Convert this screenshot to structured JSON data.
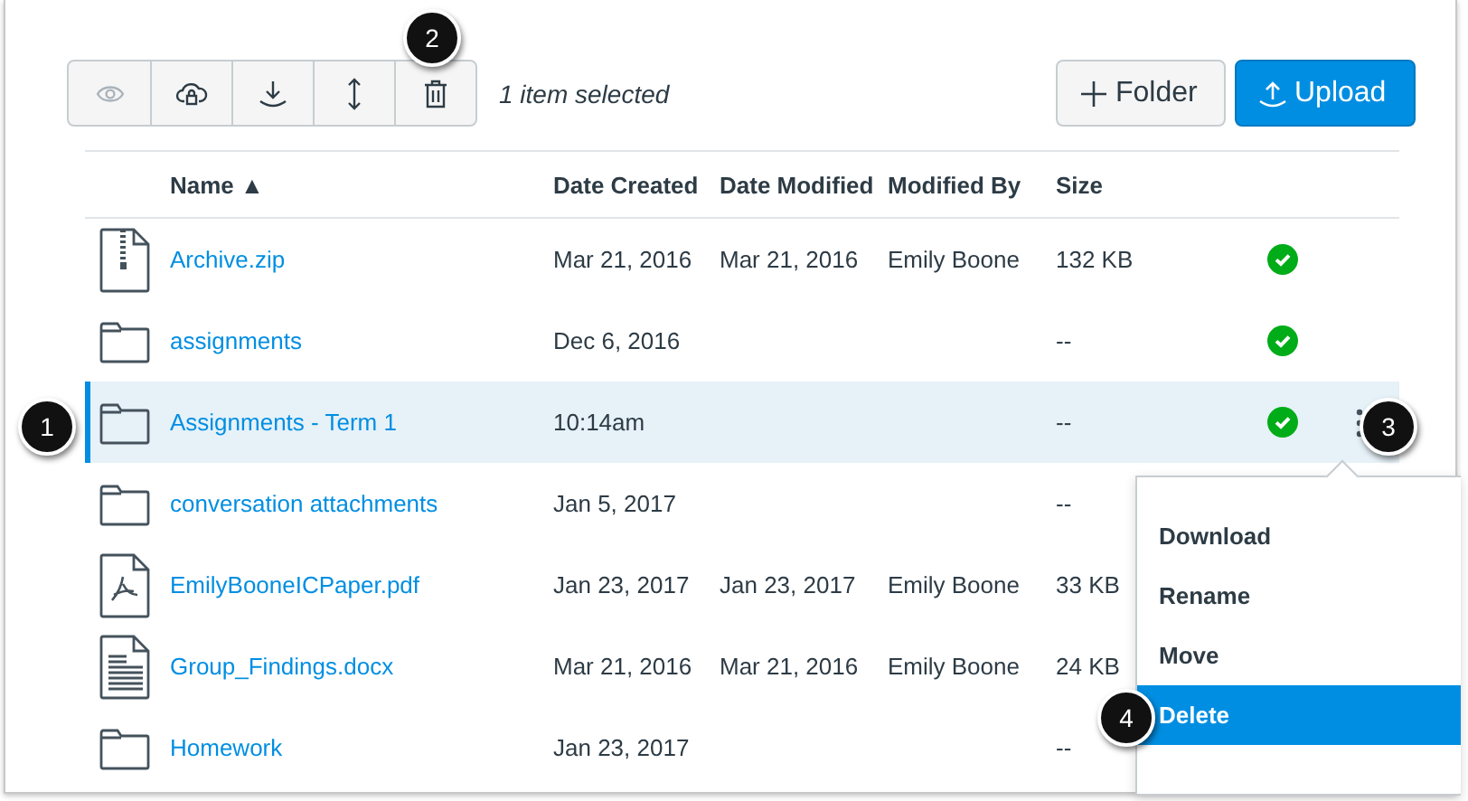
{
  "toolbar": {
    "buttons": [
      {
        "kind": "eye",
        "disabled": true
      },
      {
        "kind": "cloud-lock",
        "disabled": false
      },
      {
        "kind": "download",
        "disabled": false
      },
      {
        "kind": "move",
        "disabled": false
      },
      {
        "kind": "trash",
        "disabled": false
      }
    ],
    "selection_text": "1 item selected"
  },
  "actions": [
    {
      "kind": "folder",
      "label": "Folder"
    },
    {
      "kind": "upload",
      "label": "Upload"
    }
  ],
  "table": {
    "columns": [
      "Name ▲",
      "Date Created",
      "Date Modified",
      "Modified By",
      "Size"
    ],
    "rows": [
      {
        "kind": "zip",
        "name": "Archive.zip",
        "date_created": "Mar 21, 2016",
        "date_modified": "Mar 21, 2016",
        "modified_by": "Emily Boone",
        "size": "132 KB",
        "published": true,
        "selected": false
      },
      {
        "kind": "folder",
        "name": "assignments",
        "date_created": "Dec 6, 2016",
        "size": "--",
        "published": true,
        "selected": false
      },
      {
        "kind": "folder",
        "name": "Assignments - Term 1",
        "date_created": "10:14am",
        "size": "--",
        "published": true,
        "selected": true
      },
      {
        "kind": "folder",
        "name": "conversation attachments",
        "date_created": "Jan 5, 2017",
        "size": "--",
        "selected": false
      },
      {
        "kind": "pdf",
        "name": "EmilyBooneICPaper.pdf",
        "date_created": "Jan 23, 2017",
        "date_modified": "Jan 23, 2017",
        "modified_by": "Emily Boone",
        "size": "33 KB",
        "selected": false
      },
      {
        "kind": "docx",
        "name": "Group_Findings.docx",
        "date_created": "Mar 21, 2016",
        "date_modified": "Mar 21, 2016",
        "modified_by": "Emily Boone",
        "size": "24 KB",
        "selected": false
      },
      {
        "kind": "folder",
        "name": "Homework",
        "date_created": "Jan 23, 2017",
        "size": "--",
        "selected": false
      }
    ]
  },
  "menu": {
    "items": [
      {
        "label": "Download",
        "selected": false
      },
      {
        "label": "Rename",
        "selected": false
      },
      {
        "label": "Move",
        "selected": false
      },
      {
        "label": "Delete",
        "selected": true
      }
    ]
  },
  "callouts": [
    {
      "label": "1",
      "kind": "row"
    },
    {
      "label": "2",
      "kind": "trash"
    },
    {
      "label": "3",
      "kind": "menu"
    },
    {
      "label": "4",
      "kind": "delete"
    }
  ]
}
